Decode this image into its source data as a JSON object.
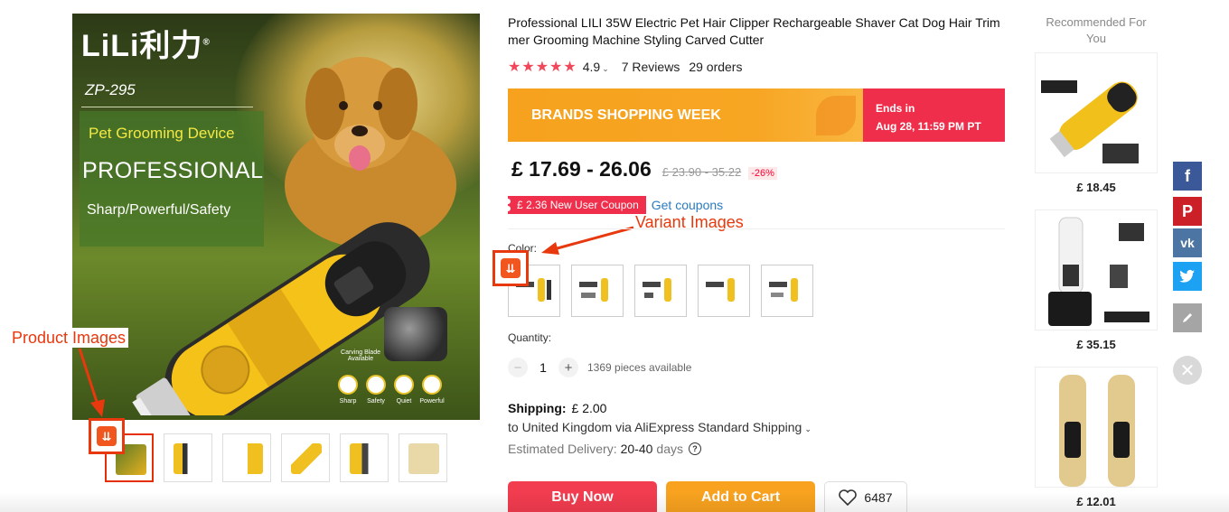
{
  "product": {
    "title": "Professional LILI 35W Electric Pet Hair Clipper Rechargeable Shaver Cat Dog Hair Trimmer Grooming Machine Styling Carved Cutter",
    "rating": "4.9",
    "reviews": "7 Reviews",
    "orders": "29 orders"
  },
  "main_image": {
    "brand": "LiLi利力",
    "brand_mark": "®",
    "model": "ZP-295",
    "tagline": "Pet Grooming Device",
    "headline": "PROFESSIONAL",
    "subline": "Sharp/Powerful/Safety",
    "blade_note": "Carving Blade Available",
    "features": [
      "Sharp",
      "Safety",
      "Quiet",
      "Powerful"
    ]
  },
  "banner": {
    "label": "BRANDS SHOPPING WEEK",
    "ends_label": "Ends in",
    "ends_time": "Aug 28, 11:59 PM PT"
  },
  "price": {
    "current": "£ 17.69 - 26.06",
    "original": "£ 23.90 - 35.22",
    "discount": "-26%"
  },
  "coupon": {
    "label": "£ 2.36 New User Coupon",
    "link": "Get coupons"
  },
  "variants": {
    "label": "Color:",
    "count": 5
  },
  "quantity": {
    "label": "Quantity:",
    "value": "1",
    "minus": "−",
    "plus": "+",
    "available": "1369 pieces available"
  },
  "shipping": {
    "label": "Shipping:",
    "cost": "£ 2.00",
    "destination": "to United Kingdom via AliExpress Standard Shipping",
    "delivery_label": "Estimated Delivery:",
    "delivery_value": "20-40",
    "delivery_unit": "days"
  },
  "actions": {
    "buy_now": "Buy Now",
    "add_to_cart": "Add to Cart",
    "wishlist_count": "6487"
  },
  "recommended": {
    "title": "Recommended For You",
    "items": [
      {
        "price": "£ 18.45"
      },
      {
        "price": "£ 35.15"
      },
      {
        "price": "£ 12.01"
      }
    ]
  },
  "annotations": {
    "product_images": "Product Images",
    "variant_images": "Variant Images"
  },
  "colors": {
    "accent_red": "#f23c4f",
    "accent_orange": "#f8a21f",
    "annotation": "#e8380d",
    "star": "#f2475a"
  },
  "social": [
    "facebook-icon",
    "pinterest-icon",
    "vk-icon",
    "twitter-icon",
    "edit-icon",
    "close-icon"
  ]
}
